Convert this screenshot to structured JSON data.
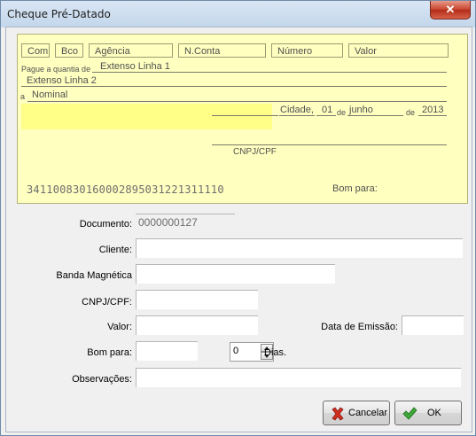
{
  "window": {
    "title": "Cheque Pré-Datado",
    "close_glyph": "✕"
  },
  "cheque": {
    "headers": [
      "Com",
      "Bco",
      "Agência",
      "N.Conta",
      "Número",
      "Valor"
    ],
    "pague_label": "Pague a quantia de",
    "extenso1": "Extenso Linha 1",
    "extenso2": "Extenso Linha 2",
    "a_label": "a",
    "nominal": "Nominal",
    "cidade": "Cidade,",
    "dia": "01",
    "de1": "de",
    "mes": "junho",
    "de2": "de",
    "ano": "2013",
    "cnpj_cpf": "CNPJ/CPF",
    "micr": "341100830160002895031221311110",
    "bom_para": "Bom para:",
    "highlight_color": "#ffff88",
    "background_color": "#ffffc0"
  },
  "form": {
    "documento_label": "Documento:",
    "documento_value": "0000000127",
    "cliente_label": "Cliente:",
    "banda_label": "Banda Magnética",
    "cnpj_label": "CNPJ/CPF:",
    "valor_label": "Valor:",
    "data_emissao_label": "Data de Emissão:",
    "bom_para_label": "Bom para:",
    "dias_value": "0",
    "dias_label": "Dias.",
    "obs_label": "Observações:"
  },
  "buttons": {
    "cancel": "Cancelar",
    "ok": "OK",
    "cancel_icon": "red-x-icon",
    "ok_icon": "green-check-icon"
  }
}
